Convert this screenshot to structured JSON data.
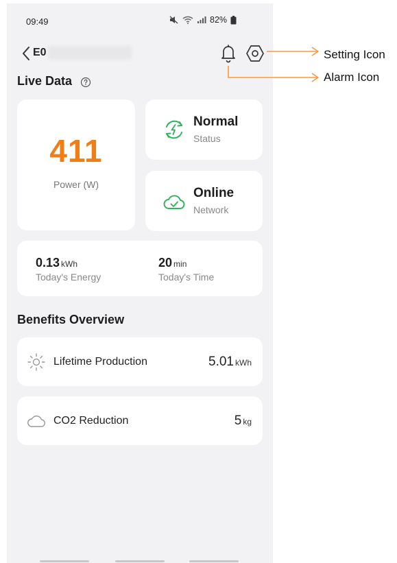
{
  "status_bar": {
    "time": "09:49",
    "battery": "82%"
  },
  "header": {
    "device_name": "E0"
  },
  "live_data": {
    "title": "Live Data",
    "power": {
      "value": "411",
      "label": "Power (W)"
    },
    "status": {
      "value": "Normal",
      "label": "Status"
    },
    "network": {
      "value": "Online",
      "label": "Network"
    },
    "energy": {
      "value": "0.13",
      "unit": "kWh",
      "label": "Today's Energy"
    },
    "time": {
      "value": "20",
      "unit": "min",
      "label": "Today's Time"
    }
  },
  "benefits": {
    "title": "Benefits Overview",
    "items": [
      {
        "label": "Lifetime Production",
        "value": "5.01",
        "unit": "kWh",
        "icon": "sun-icon"
      },
      {
        "label": "CO2 Reduction",
        "value": "5",
        "unit": "kg",
        "icon": "cloud-icon"
      }
    ]
  },
  "annotations": {
    "setting": "Setting Icon",
    "alarm": "Alarm Icon"
  },
  "colors": {
    "accent_orange": "#f07e14",
    "accent_green": "#2fb35a",
    "app_background": "#f2f2f4",
    "card": "#ffffff"
  }
}
